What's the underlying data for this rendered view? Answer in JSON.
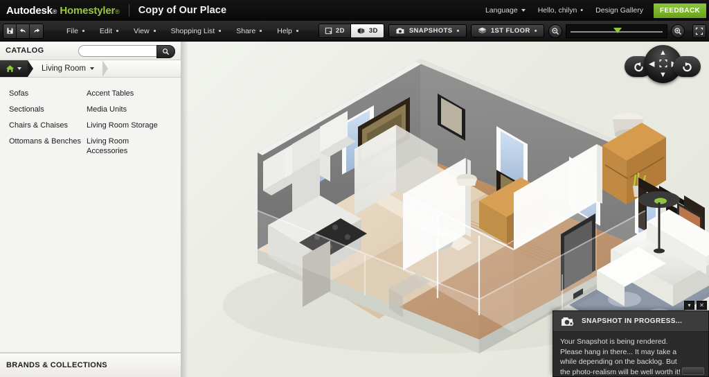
{
  "brand": {
    "company": "Autodesk",
    "company_reg": "®",
    "product": "Homestyler",
    "product_reg": "®",
    "document_title": "Copy of Our Place"
  },
  "account": {
    "language_label": "Language",
    "user_label": "Hello, chilyn",
    "design_gallery_label": "Design Gallery",
    "feedback_label": "FEEDBACK",
    "feedback_color": "#8cc63f"
  },
  "toolbar": {
    "save_icon": "floppy-disk-icon",
    "undo_icon": "undo-arrow-icon",
    "redo_icon": "redo-arrow-icon",
    "menus": [
      {
        "label": "File"
      },
      {
        "label": "Edit"
      },
      {
        "label": "View"
      },
      {
        "label": "Shopping List"
      },
      {
        "label": "Share"
      },
      {
        "label": "Help"
      }
    ],
    "view_modes": [
      {
        "label": "2D",
        "active": false,
        "icon": "floorplan-2d-icon"
      },
      {
        "label": "3D",
        "active": true,
        "icon": "cube-3d-icon"
      }
    ],
    "snapshots_label": "SNAPSHOTS",
    "snapshots_icon": "camera-icon",
    "floor_label": "1ST FLOOR",
    "floor_icon": "layers-icon",
    "zoom_out_icon": "zoom-out-icon",
    "zoom_in_icon": "zoom-in-icon",
    "fullscreen_icon": "fullscreen-icon",
    "zoom_slider_percent": 45,
    "slider_handle_color": "#8ec63f"
  },
  "sidebar": {
    "catalog_title": "CATALOG",
    "search": {
      "value": "",
      "placeholder": "",
      "button_icon": "search-icon"
    },
    "breadcrumb": {
      "home_icon": "home-icon",
      "home_caret": "▾",
      "current": "Living Room",
      "current_caret": "▾"
    },
    "categories_col1": [
      {
        "label": "Sofas"
      },
      {
        "label": "Sectionals"
      },
      {
        "label": "Chairs & Chaises"
      },
      {
        "label": "Ottomans & Benches"
      }
    ],
    "categories_col2": [
      {
        "label": "Accent Tables"
      },
      {
        "label": "Media Units"
      },
      {
        "label": "Living Room Storage"
      },
      {
        "label": "Living Room Accessories"
      }
    ],
    "brands_title": "BRANDS & COLLECTIONS"
  },
  "canvas": {
    "nav_widget": {
      "rotate_left_icon": "rotate-left-icon",
      "rotate_right_icon": "rotate-right-icon",
      "pan_up_icon": "chevron-up-icon",
      "pan_down_icon": "chevron-down-icon",
      "pan_left_icon": "chevron-left-icon",
      "pan_right_icon": "chevron-right-icon",
      "recenter_icon": "recenter-icon"
    }
  },
  "popup": {
    "icon": "camera-icon",
    "title": "SNAPSHOT IN PROGRESS...",
    "collapse_icon": "▾",
    "close_icon": "✕",
    "lines": [
      "Your Snapshot is being rendered.",
      "Please hang in there... It may take a",
      "while depending on the backlog. But",
      "the photo-realism will be well worth it!"
    ]
  }
}
